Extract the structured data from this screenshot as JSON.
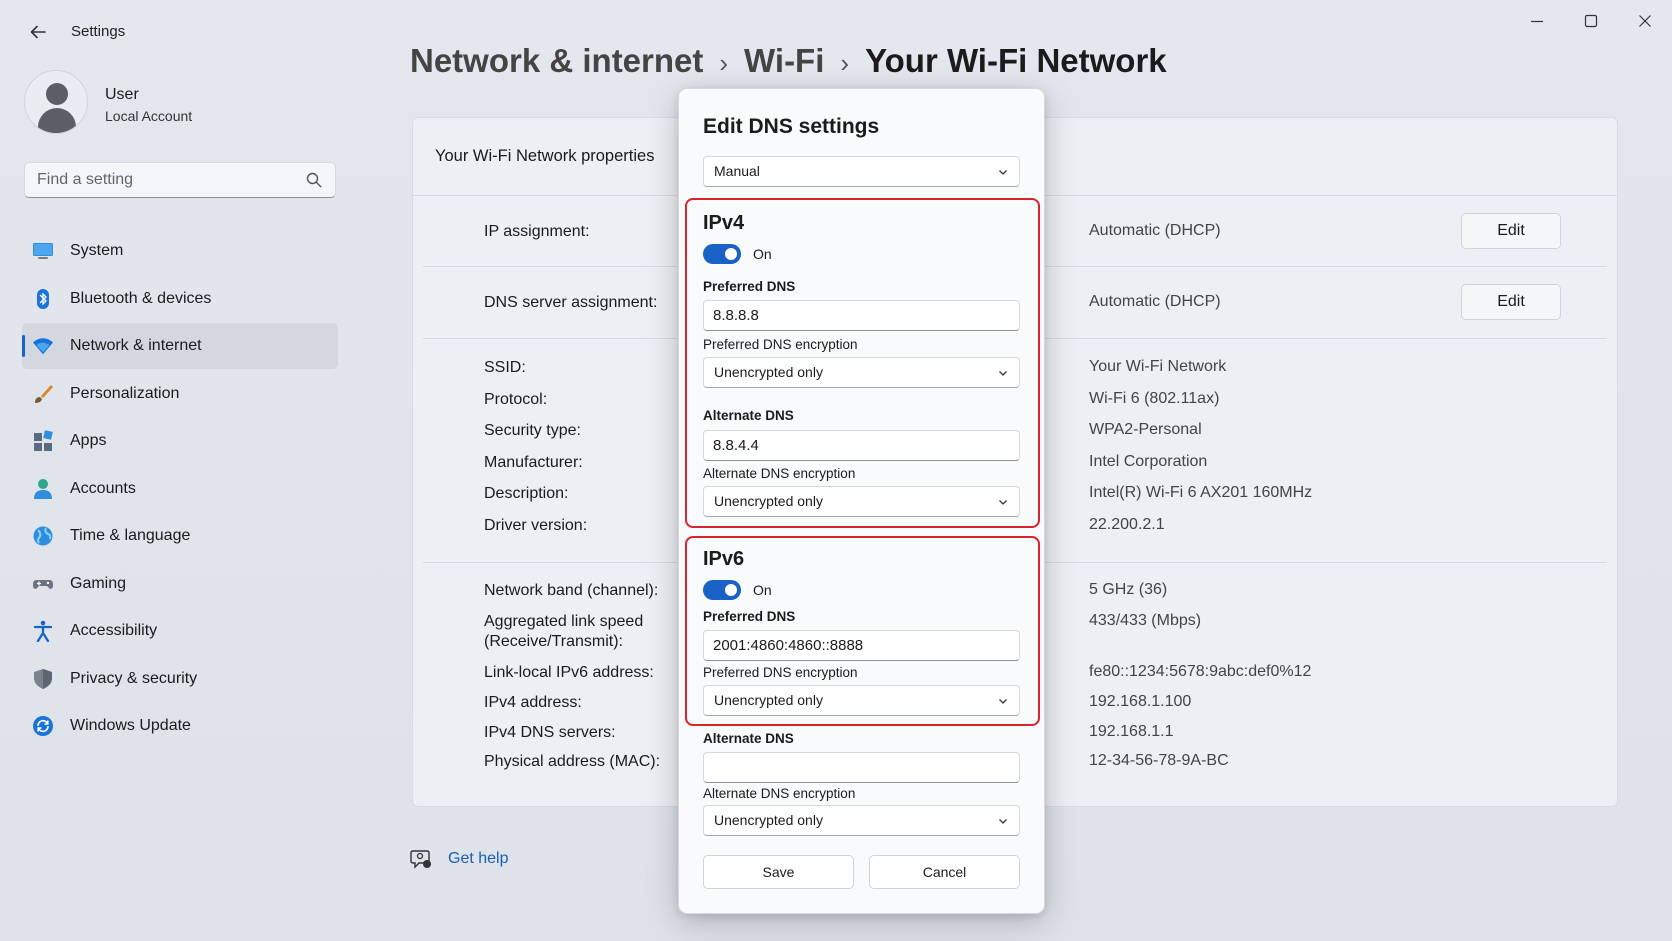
{
  "app": {
    "title": "Settings",
    "controls": {
      "minimize": "minimize-icon",
      "maximize": "maximize-icon",
      "close": "close-icon"
    }
  },
  "profile": {
    "name": "User",
    "account_type": "Local Account"
  },
  "search": {
    "placeholder": "Find a setting"
  },
  "sidebar": {
    "items": [
      {
        "label": "System",
        "icon": "monitor-icon",
        "active": false
      },
      {
        "label": "Bluetooth & devices",
        "icon": "bluetooth-icon",
        "active": false
      },
      {
        "label": "Network & internet",
        "icon": "wifi-icon",
        "active": true
      },
      {
        "label": "Personalization",
        "icon": "brush-icon",
        "active": false
      },
      {
        "label": "Apps",
        "icon": "apps-icon",
        "active": false
      },
      {
        "label": "Accounts",
        "icon": "person-icon",
        "active": false
      },
      {
        "label": "Time & language",
        "icon": "globe-icon",
        "active": false
      },
      {
        "label": "Gaming",
        "icon": "controller-icon",
        "active": false
      },
      {
        "label": "Accessibility",
        "icon": "accessibility-icon",
        "active": false
      },
      {
        "label": "Privacy & security",
        "icon": "shield-icon",
        "active": false
      },
      {
        "label": "Windows Update",
        "icon": "update-icon",
        "active": false
      }
    ]
  },
  "breadcrumb": {
    "parts": [
      "Network & internet",
      "Wi-Fi"
    ],
    "separator": "›",
    "current": "Your Wi-Fi Network"
  },
  "properties": {
    "title": "Your Wi-Fi Network properties",
    "ip_assignment": {
      "label": "IP assignment:",
      "value": "Automatic (DHCP)",
      "button": "Edit"
    },
    "dns_assignment": {
      "label": "DNS server assignment:",
      "value": "Automatic (DHCP)",
      "button": "Edit"
    },
    "details": [
      {
        "label": "SSID:",
        "value": "Your Wi-Fi Network"
      },
      {
        "label": "Protocol:",
        "value": "Wi-Fi 6 (802.11ax)"
      },
      {
        "label": "Security type:",
        "value": "WPA2-Personal"
      },
      {
        "label": "Manufacturer:",
        "value": "Intel Corporation"
      },
      {
        "label": "Description:",
        "value": "Intel(R) Wi-Fi 6 AX201 160MHz"
      },
      {
        "label": "Driver version:",
        "value": "22.200.2.1"
      }
    ],
    "details2": [
      {
        "label": "Network band (channel):",
        "value": "5 GHz (36)"
      },
      {
        "label": "Aggregated link speed",
        "label2": "(Receive/Transmit):",
        "value": "433/433 (Mbps)"
      },
      {
        "label": "Link-local IPv6 address:",
        "value": "fe80::1234:5678:9abc:def0%12"
      },
      {
        "label": "IPv4 address:",
        "value": "192.168.1.100"
      },
      {
        "label": "IPv4 DNS servers:",
        "value": "192.168.1.1"
      },
      {
        "label": "Physical address (MAC):",
        "value": "12-34-56-78-9A-BC"
      }
    ]
  },
  "help": {
    "label": "Get help"
  },
  "dialog": {
    "title": "Edit DNS settings",
    "mode": "Manual",
    "ipv4": {
      "title": "IPv4",
      "toggle_label": "On",
      "toggle_on": true,
      "preferred_label": "Preferred DNS",
      "preferred_value": "8.8.8.8",
      "preferred_enc_label": "Preferred DNS encryption",
      "preferred_enc_value": "Unencrypted only",
      "alternate_label": "Alternate DNS",
      "alternate_value": "8.8.4.4",
      "alternate_enc_label": "Alternate DNS encryption",
      "alternate_enc_value": "Unencrypted only"
    },
    "ipv6": {
      "title": "IPv6",
      "toggle_label": "On",
      "toggle_on": true,
      "preferred_label": "Preferred DNS",
      "preferred_value": "2001:4860:4860::8888",
      "preferred_enc_label": "Preferred DNS encryption",
      "preferred_enc_value": "Unencrypted only",
      "alternate_label": "Alternate DNS",
      "alternate_value": "",
      "alternate_enc_label": "Alternate DNS encryption",
      "alternate_enc_value": "Unencrypted only"
    },
    "save_label": "Save",
    "cancel_label": "Cancel"
  },
  "colors": {
    "accent": "#1a63c6",
    "highlight": "#d9232d",
    "link": "#1a5fb4"
  }
}
